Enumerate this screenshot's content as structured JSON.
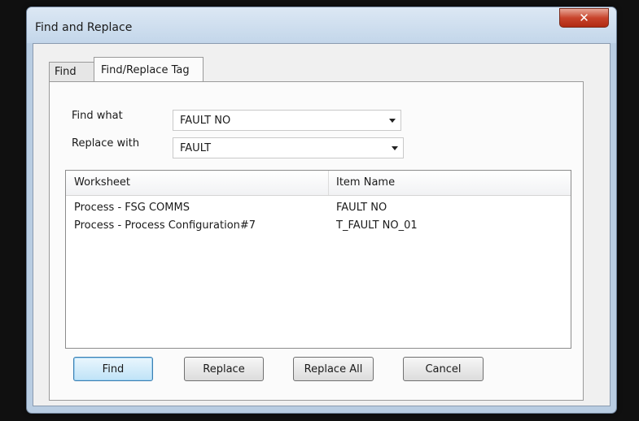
{
  "window": {
    "title": "Find and Replace",
    "close_glyph": "✕"
  },
  "tabs": [
    {
      "label": "Find",
      "active": false
    },
    {
      "label": "Find/Replace Tag",
      "active": true
    }
  ],
  "form": {
    "find_label": "Find what",
    "find_value": "FAULT NO",
    "replace_label": "Replace with",
    "replace_value": "FAULT"
  },
  "results": {
    "columns": [
      "Worksheet",
      "Item Name"
    ],
    "rows": [
      [
        "Process - FSG COMMS",
        "FAULT NO"
      ],
      [
        "Process - Process Configuration#7",
        "T_FAULT NO_01"
      ]
    ]
  },
  "buttons": {
    "find": "Find",
    "replace": "Replace",
    "replace_all": "Replace All",
    "cancel": "Cancel"
  },
  "colors": {
    "close_button": "#c8442c",
    "default_button_border": "#3c7fb1"
  }
}
